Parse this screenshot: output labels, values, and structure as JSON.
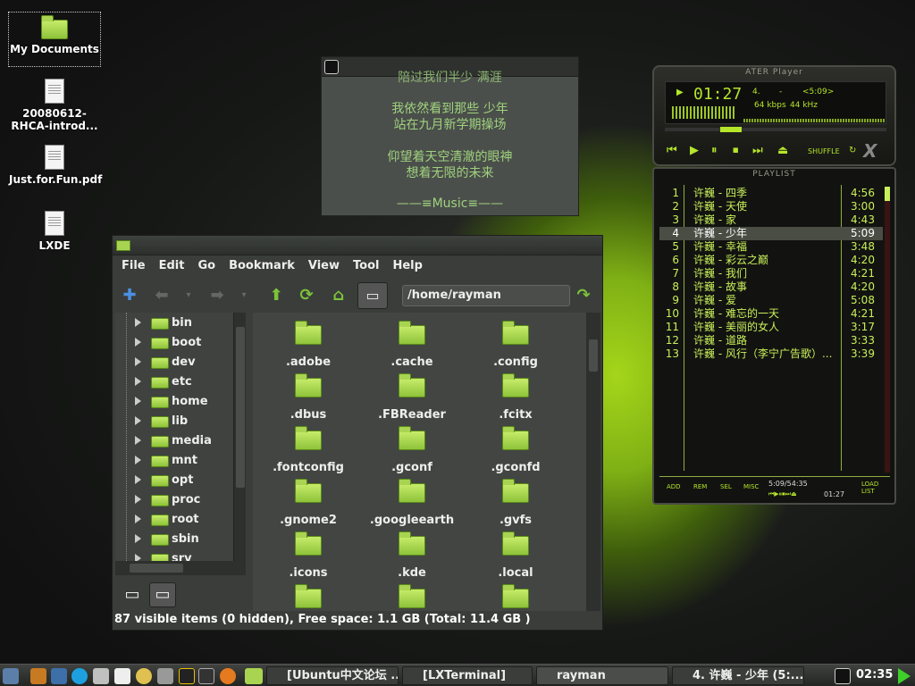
{
  "desktop": {
    "icons": [
      {
        "label": "My Documents",
        "icon": "home-folder-icon"
      },
      {
        "label": "20080612-RHCA-introd...",
        "icon": "document-icon"
      },
      {
        "label": "Just.for.Fun.pdf",
        "icon": "pdf-icon"
      },
      {
        "label": "LXDE",
        "icon": "text-file-icon"
      }
    ]
  },
  "lyrics": {
    "partial": "陪过我们半少 满涯",
    "l1": "我依然看到那些 少年",
    "l2": "站在九月新学期操场",
    "l3": "仰望着天空清澈的眼神",
    "l4": "想着无限的未来",
    "footer": "——≡Music≡——"
  },
  "fm": {
    "menu": [
      "File",
      "Edit",
      "Go",
      "Bookmark",
      "View",
      "Tool",
      "Help"
    ],
    "path": "/home/rayman",
    "tree": [
      "bin",
      "boot",
      "dev",
      "etc",
      "home",
      "lib",
      "media",
      "mnt",
      "opt",
      "proc",
      "root",
      "sbin",
      "srv"
    ],
    "items": [
      ".adobe",
      ".cache",
      ".config",
      ".dbus",
      ".FBReader",
      ".fcitx",
      ".fontconfig",
      ".gconf",
      ".gconfd",
      ".gnome2",
      ".googleearth",
      ".gvfs",
      ".icons",
      ".kde",
      ".local",
      "",
      "",
      ""
    ],
    "status": "87 visible items (0 hidden), Free space: 1.1 GB (Total: 11.4 GB )"
  },
  "player": {
    "title": "ATER Player",
    "time": "01:27",
    "track": "4.",
    "dash": "-",
    "total": "<5:09>",
    "kbps": "64 kbps",
    "khz": "44 kHz",
    "shuffle": "SHUFFLE",
    "logo": "X"
  },
  "playlist": {
    "title": "PLAYLIST",
    "tracks": [
      {
        "n": "1",
        "t": "许巍 - 四季",
        "d": "4:56"
      },
      {
        "n": "2",
        "t": "许巍 - 天使",
        "d": "3:00"
      },
      {
        "n": "3",
        "t": "许巍 - 家",
        "d": "4:43"
      },
      {
        "n": "4",
        "t": "许巍 - 少年",
        "d": "5:09"
      },
      {
        "n": "5",
        "t": "许巍 - 幸福",
        "d": "3:48"
      },
      {
        "n": "6",
        "t": "许巍 - 彩云之巅",
        "d": "4:20"
      },
      {
        "n": "7",
        "t": "许巍 - 我们",
        "d": "4:21"
      },
      {
        "n": "8",
        "t": "许巍 - 故事",
        "d": "4:20"
      },
      {
        "n": "9",
        "t": "许巍 - 爱",
        "d": "5:08"
      },
      {
        "n": "10",
        "t": "许巍 - 难忘的一天",
        "d": "4:21"
      },
      {
        "n": "11",
        "t": "许巍 - 美丽的女人",
        "d": "3:17"
      },
      {
        "n": "12",
        "t": "许巍 - 道路",
        "d": "3:33"
      },
      {
        "n": "13",
        "t": "许巍 - 风行（李宁广告歌）...",
        "d": "3:39"
      }
    ],
    "current": 3,
    "buttons": [
      "ADD",
      "REM",
      "SEL",
      "MISC"
    ],
    "load": "LOAD",
    "list": "LIST",
    "progress": "5:09/54:35",
    "elapsed": "01:27"
  },
  "taskbar": {
    "tasks": [
      "[Ubuntu中文论坛 ...",
      "[LXTerminal]",
      "rayman",
      "4. 许巍 - 少年 (5:..."
    ],
    "clock": "02:35"
  },
  "colors": {
    "accent": "#b6e62a",
    "folder": "#a9d452"
  }
}
